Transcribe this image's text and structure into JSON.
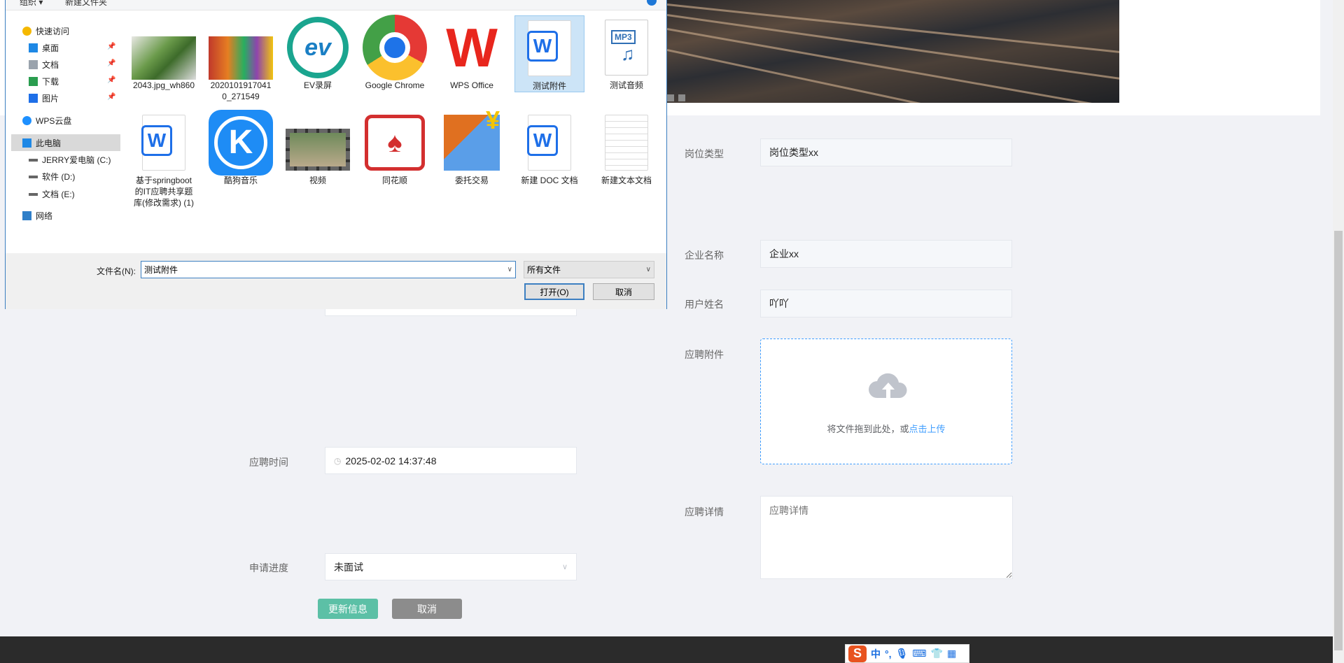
{
  "dialog": {
    "toolbar": {
      "organize": "组织 ▾",
      "new_folder": "新建文件夹"
    },
    "nav": [
      {
        "label": "快速访问",
        "icon": "star-icon"
      },
      {
        "label": "桌面",
        "icon": "desktop-icon",
        "pinned": true
      },
      {
        "label": "文档",
        "icon": "document-icon",
        "pinned": true
      },
      {
        "label": "下载",
        "icon": "download-icon",
        "pinned": true
      },
      {
        "label": "图片",
        "icon": "pictures-icon",
        "pinned": true
      },
      {
        "label": "WPS云盘",
        "icon": "cloud-icon"
      },
      {
        "label": "此电脑",
        "icon": "computer-icon",
        "selected": true
      },
      {
        "label": "JERRY爱电脑 (C:)",
        "icon": "drive-icon"
      },
      {
        "label": "软件 (D:)",
        "icon": "drive-icon"
      },
      {
        "label": "文档 (E:)",
        "icon": "drive-icon"
      },
      {
        "label": "网络",
        "icon": "network-icon"
      }
    ],
    "files": [
      {
        "name": "2043.jpg_wh860",
        "icon": "image-thumbnail-broccoli"
      },
      {
        "name": "20201019170410_271549",
        "icon": "image-thumbnail-vegetables"
      },
      {
        "name": "EV录屏",
        "icon": "ev-recorder-icon"
      },
      {
        "name": "Google Chrome",
        "icon": "chrome-icon"
      },
      {
        "name": "WPS Office",
        "icon": "wps-office-icon"
      },
      {
        "name": "测试附件",
        "icon": "wps-doc-icon",
        "selected": true
      },
      {
        "name": "测试音频",
        "icon": "mp3-icon",
        "badge": "MP3"
      },
      {
        "name": "基于springboot的IT应聘共享题库(修改需求) (1)",
        "icon": "wps-doc-icon"
      },
      {
        "name": "酷狗音乐",
        "icon": "kugou-icon"
      },
      {
        "name": "视频",
        "icon": "video-icon"
      },
      {
        "name": "同花顺",
        "icon": "tonghuashun-icon"
      },
      {
        "name": "委托交易",
        "icon": "trade-icon"
      },
      {
        "name": "新建 DOC 文档",
        "icon": "wps-doc-icon"
      },
      {
        "name": "新建文本文档",
        "icon": "text-file-icon"
      }
    ],
    "filename_label": "文件名(N):",
    "filename_value": "测试附件",
    "filter_value": "所有文件",
    "open_label": "打开(O)",
    "cancel_label": "取消"
  },
  "form": {
    "job_type": {
      "label": "岗位类型",
      "value": "岗位类型xx"
    },
    "company": {
      "label": "企业名称",
      "value": "企业xx"
    },
    "username": {
      "label": "用户姓名",
      "value": "吖吖"
    },
    "attachment": {
      "label": "应聘附件",
      "hint": "将文件拖到此处，或",
      "link": "点击上传"
    },
    "details": {
      "label": "应聘详情",
      "placeholder": "应聘详情"
    },
    "apply_time": {
      "label": "应聘时间",
      "value": "2025-02-02 14:37:48"
    },
    "progress": {
      "label": "申请进度",
      "value": "未面试"
    },
    "submit_label": "更新信息",
    "cancel_label": "取消"
  },
  "ime": {
    "logo": "S",
    "mode": "中",
    "punct": "°,"
  },
  "colors": {
    "submit": "#5cc0a6",
    "cancel": "#8c8c8c",
    "link": "#409eff",
    "footer": "#2b2b2b"
  }
}
